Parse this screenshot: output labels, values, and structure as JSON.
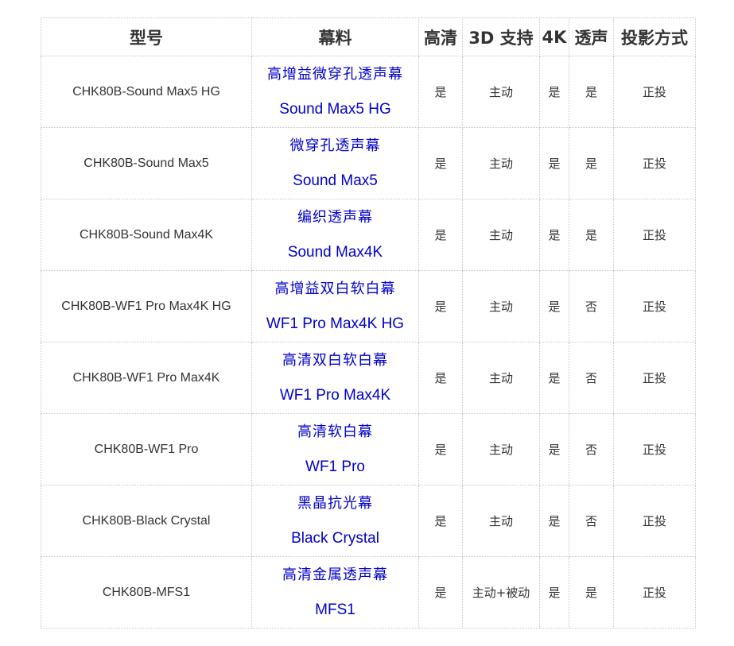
{
  "headers": [
    "型号",
    "幕料",
    "高清",
    "3D 支持",
    "4K",
    "透声",
    "投影方式"
  ],
  "rows": [
    {
      "model": "CHK80B-Sound Max5 HG",
      "screen_cn": "高增益微穿孔透声幕",
      "screen_en": "Sound Max5 HG",
      "hd": "是",
      "support_3d": "主动",
      "uhd_4k": "是",
      "acoustic": "是",
      "projection": "正投"
    },
    {
      "model": "CHK80B-Sound Max5",
      "screen_cn": "微穿孔透声幕",
      "screen_en": "Sound Max5",
      "hd": "是",
      "support_3d": "主动",
      "uhd_4k": "是",
      "acoustic": "是",
      "projection": "正投"
    },
    {
      "model": "CHK80B-Sound Max4K",
      "screen_cn": "编织透声幕",
      "screen_en": "Sound Max4K",
      "hd": "是",
      "support_3d": "主动",
      "uhd_4k": "是",
      "acoustic": "是",
      "projection": "正投"
    },
    {
      "model": "CHK80B-WF1 Pro Max4K HG",
      "screen_cn": "高增益双白软白幕",
      "screen_en": "WF1 Pro Max4K HG",
      "hd": "是",
      "support_3d": "主动",
      "uhd_4k": "是",
      "acoustic": "否",
      "projection": "正投"
    },
    {
      "model": "CHK80B-WF1 Pro Max4K",
      "screen_cn": "高清双白软白幕",
      "screen_en": "WF1 Pro Max4K",
      "hd": "是",
      "support_3d": "主动",
      "uhd_4k": "是",
      "acoustic": "否",
      "projection": "正投"
    },
    {
      "model": "CHK80B-WF1 Pro",
      "screen_cn": "高清软白幕",
      "screen_en": "WF1 Pro",
      "hd": "是",
      "support_3d": "主动",
      "uhd_4k": "是",
      "acoustic": "否",
      "projection": "正投"
    },
    {
      "model": "CHK80B-Black Crystal",
      "screen_cn": "黑晶抗光幕",
      "screen_en": "Black Crystal",
      "hd": "是",
      "support_3d": "主动",
      "uhd_4k": "是",
      "acoustic": "否",
      "projection": "正投"
    },
    {
      "model": "CHK80B-MFS1",
      "screen_cn": "高清金属透声幕",
      "screen_en": "MFS1",
      "hd": "是",
      "support_3d": "主动+被动",
      "uhd_4k": "是",
      "acoustic": "是",
      "projection": "正投"
    }
  ]
}
